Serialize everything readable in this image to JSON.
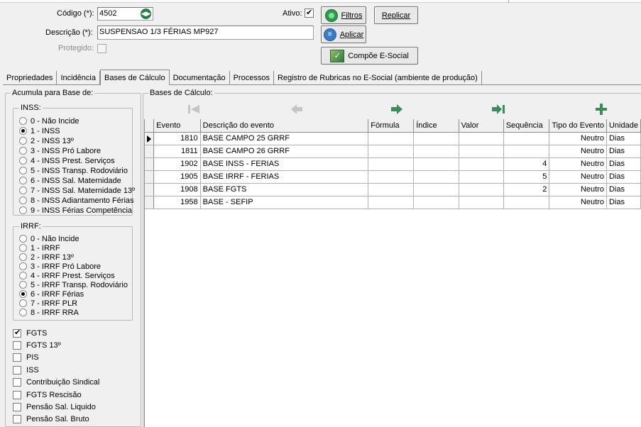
{
  "header": {
    "codigo_label": "Código (*):",
    "codigo_value": "4502",
    "descricao_label": "Descrição (*):",
    "descricao_value": "SUSPENSAO 1/3 FÉRIAS MP927",
    "protegido_label": "Protegido:",
    "ativo_label": "Ativo:",
    "ativo_checked": true,
    "protegido_checked": false
  },
  "buttons": {
    "filtros": "Filtros",
    "replicar": "Replicar",
    "aplicar": "Aplicar",
    "compoe": "Compõe E-Social"
  },
  "tabs": [
    {
      "label": "Propriedades",
      "active": false
    },
    {
      "label": "Incidência",
      "active": false
    },
    {
      "label": "Bases de Cálculo",
      "active": true
    },
    {
      "label": "Documentação",
      "active": false
    },
    {
      "label": "Processos",
      "active": false
    },
    {
      "label": "Registro de Rubricas no E-Social (ambiente de produção)",
      "active": false
    }
  ],
  "left_panel": {
    "title": "Acumula para Base de:",
    "inss": {
      "title": "INSS:",
      "options": [
        {
          "label": "0 - Não Incide",
          "selected": false
        },
        {
          "label": "1 - INSS",
          "selected": true
        },
        {
          "label": "2 - INSS 13º",
          "selected": false
        },
        {
          "label": "3 - INSS Pró Labore",
          "selected": false
        },
        {
          "label": "4 - INSS Prest. Serviços",
          "selected": false
        },
        {
          "label": "5 - INSS Transp. Rodoviário",
          "selected": false
        },
        {
          "label": "6 - INSS Sal. Maternidade",
          "selected": false
        },
        {
          "label": "7 - INSS Sal. Maternidade 13º",
          "selected": false
        },
        {
          "label": "8 - INSS Adiantamento Férias",
          "selected": false
        },
        {
          "label": "9 - INSS Férias Competência",
          "selected": false
        }
      ]
    },
    "irrf": {
      "title": "IRRF:",
      "options": [
        {
          "label": "0 - Não Incide",
          "selected": false
        },
        {
          "label": "1 - IRRF",
          "selected": false
        },
        {
          "label": "2 - IRRF 13º",
          "selected": false
        },
        {
          "label": "3 - IRRF Pró Labore",
          "selected": false
        },
        {
          "label": "4 - IRRF Prest. Serviços",
          "selected": false
        },
        {
          "label": "5 - IRRF Transp. Rodoviário",
          "selected": false
        },
        {
          "label": "6 - IRRF Férias",
          "selected": true
        },
        {
          "label": "7 - IRRF PLR",
          "selected": false
        },
        {
          "label": "8 - IRRF RRA",
          "selected": false
        }
      ]
    },
    "checks": [
      {
        "label": "FGTS",
        "checked": true
      },
      {
        "label": "FGTS 13º",
        "checked": false
      },
      {
        "label": "PIS",
        "checked": false
      },
      {
        "label": "ISS",
        "checked": false
      },
      {
        "label": "Contribuição Sindical",
        "checked": false
      },
      {
        "label": "FGTS Rescisão",
        "checked": false
      },
      {
        "label": "Pensão Sal. Liquido",
        "checked": false
      },
      {
        "label": "Pensão Sal. Bruto",
        "checked": false
      }
    ]
  },
  "right_panel": {
    "title": "Bases de Cálculo:",
    "nav_icons": [
      "first-record-icon",
      "previous-record-icon",
      "next-record-icon",
      "last-record-icon",
      "add-record-icon"
    ],
    "columns": [
      "Evento",
      "Descrição do evento",
      "Fórmula",
      "Índice",
      "Valor",
      "Sequência",
      "Tipo do Evento",
      "Unidade"
    ],
    "rows": [
      {
        "evento": "1810",
        "descricao": "BASE CAMPO 25 GRRF",
        "formula": "",
        "indice": "",
        "valor": "",
        "sequencia": "",
        "tipo": "Neutro",
        "unidade": "Dias",
        "current": true
      },
      {
        "evento": "1811",
        "descricao": "BASE CAMPO 26 GRRF",
        "formula": "",
        "indice": "",
        "valor": "",
        "sequencia": "",
        "tipo": "Neutro",
        "unidade": "Dias",
        "current": false
      },
      {
        "evento": "1902",
        "descricao": "BASE INSS - FERIAS",
        "formula": "",
        "indice": "",
        "valor": "",
        "sequencia": "4",
        "tipo": "Neutro",
        "unidade": "Dias",
        "current": false
      },
      {
        "evento": "1905",
        "descricao": "BASE IRRF - FERIAS",
        "formula": "",
        "indice": "",
        "valor": "",
        "sequencia": "5",
        "tipo": "Neutro",
        "unidade": "Dias",
        "current": false
      },
      {
        "evento": "1908",
        "descricao": "BASE FGTS",
        "formula": "",
        "indice": "",
        "valor": "",
        "sequencia": "2",
        "tipo": "Neutro",
        "unidade": "Dias",
        "current": false
      },
      {
        "evento": "1958",
        "descricao": "BASE - SEFIP",
        "formula": "",
        "indice": "",
        "valor": "",
        "sequencia": "",
        "tipo": "Neutro",
        "unidade": "Dias",
        "current": false
      }
    ]
  },
  "colors": {
    "window_bg": "#f0f0f0",
    "accent_green": "#2e9a4e",
    "nav_green": "#3f8a5a",
    "disabled": "#8a8a8a"
  }
}
